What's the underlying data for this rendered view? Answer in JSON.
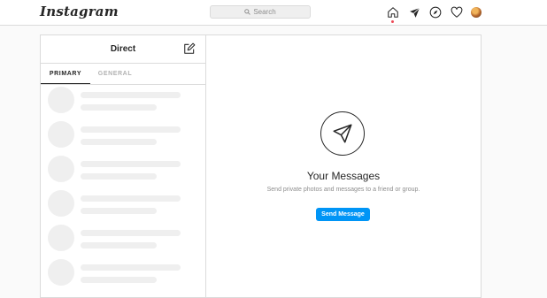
{
  "header": {
    "logo": "Instagram",
    "search_placeholder": "Search",
    "nav_icons": [
      "home-icon",
      "direct-icon",
      "explore-icon",
      "activity-heart-icon",
      "profile-avatar"
    ],
    "active_indicator_color": "#ed4956"
  },
  "inbox": {
    "title": "Direct",
    "new_message_icon": "compose-icon",
    "tabs": [
      {
        "label": "PRIMARY",
        "active": true
      },
      {
        "label": "GENERAL",
        "active": false
      }
    ]
  },
  "empty_state": {
    "icon": "paper-plane-icon",
    "title": "Your Messages",
    "subtitle": "Send private photos and messages to a friend or group.",
    "button_label": "Send Message",
    "button_color": "#0095f6"
  }
}
